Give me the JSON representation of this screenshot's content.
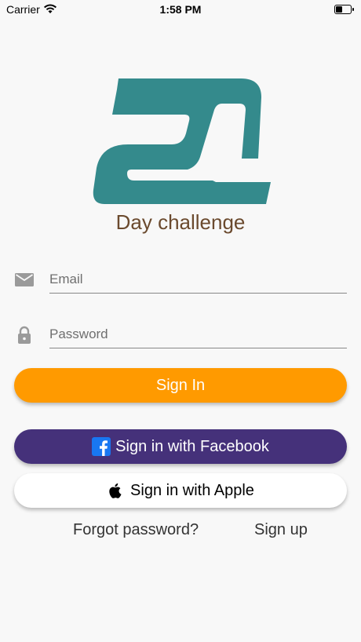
{
  "status_bar": {
    "carrier": "Carrier",
    "time": "1:58 PM"
  },
  "brand": {
    "tagline": "Day challenge",
    "logo_color": "#348a8c",
    "tagline_color": "#6b4a2e"
  },
  "form": {
    "email_placeholder": "Email",
    "password_placeholder": "Password"
  },
  "buttons": {
    "sign_in": "Sign In",
    "facebook": "Sign in with Facebook",
    "apple": "Sign in with Apple"
  },
  "links": {
    "forgot": "Forgot password?",
    "signup": "Sign up"
  },
  "colors": {
    "sign_in": "#ff9a00",
    "facebook": "#45317a",
    "apple": "#ffffff"
  },
  "icons": {
    "wifi": "wifi-icon",
    "battery": "battery-icon",
    "email": "mail-icon",
    "password": "lock-icon",
    "facebook": "facebook-icon",
    "apple": "apple-icon"
  }
}
